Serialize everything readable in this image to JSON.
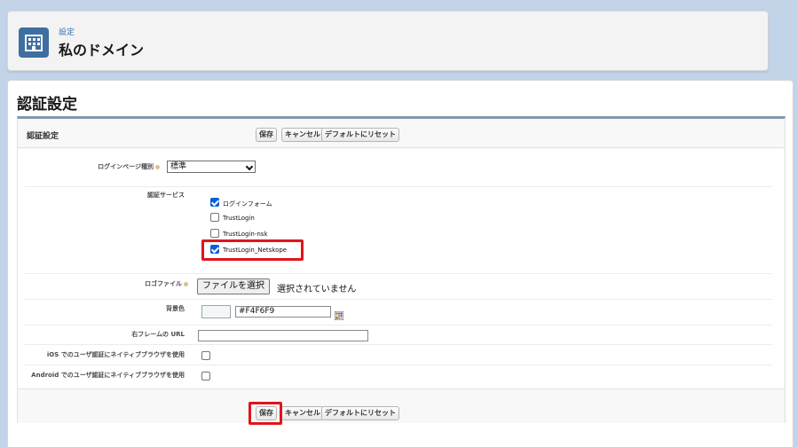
{
  "header": {
    "breadcrumb": "設定",
    "title": "私のドメイン",
    "icon": "building-icon"
  },
  "page": {
    "heading": "認証設定"
  },
  "section": {
    "title": "認証設定",
    "buttons": {
      "save": "保存",
      "cancel": "キャンセル",
      "reset": "デフォルトにリセット"
    }
  },
  "fields": {
    "login_page_type": {
      "label": "ログインページ種別",
      "value": "標準"
    },
    "auth_service": {
      "label": "認証サービス",
      "options": [
        {
          "label": "ログインフォーム",
          "checked": true
        },
        {
          "label": "TrustLogin",
          "checked": false
        },
        {
          "label": "TrustLogin-nsk",
          "checked": false
        },
        {
          "label": "TrustLogin_Netskope",
          "checked": true
        }
      ]
    },
    "logo_file": {
      "label": "ロゴファイル",
      "button": "ファイルを選択",
      "status": "選択されていません"
    },
    "background_color": {
      "label": "背景色",
      "value": "#F4F6F9"
    },
    "right_frame_url": {
      "label": "右フレームの URL",
      "value": ""
    },
    "ios_native_browser": {
      "label": "iOS でのユーザ認証にネイティブブラウザを使用",
      "checked": false
    },
    "android_native_browser": {
      "label": "Android でのユーザ認証にネイティブブラウザを使用",
      "checked": false
    }
  },
  "colors": {
    "highlight": "#e0151b",
    "header_icon_bg": "#3e6fa1",
    "checkbox_checked": "#0a5fd6"
  }
}
